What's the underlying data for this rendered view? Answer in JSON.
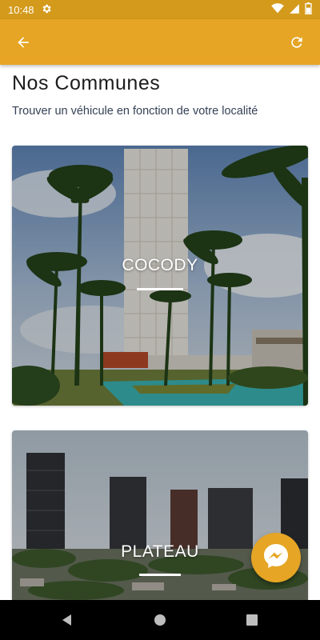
{
  "status_bar": {
    "time": "10:48"
  },
  "app_bar": {
    "back_icon": "arrow-back-icon",
    "refresh_icon": "refresh-icon"
  },
  "page": {
    "title": "Nos Communes",
    "subtitle": "Trouver un véhicule en fonction de votre localité"
  },
  "communes": [
    {
      "name": "COCODY"
    },
    {
      "name": "PLATEAU"
    }
  ],
  "fab": {
    "icon": "messenger-icon"
  },
  "colors": {
    "primary": "#e6a524",
    "status_bar": "#d49a1c"
  }
}
